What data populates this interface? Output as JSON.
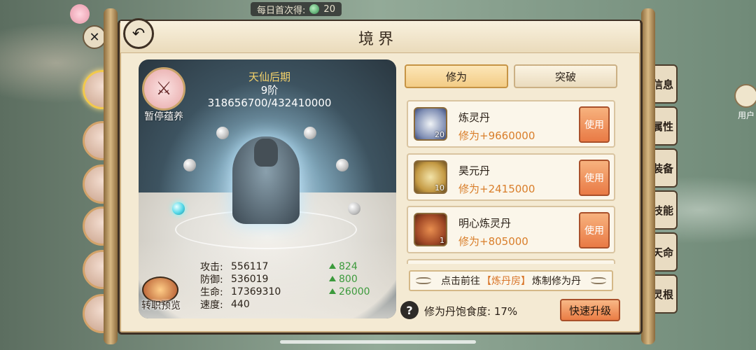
{
  "hud": {
    "daily_first_label": "每日首次得:",
    "daily_first_value": "20",
    "daily_icon": "jade-gem-icon"
  },
  "panel": {
    "title": "境界"
  },
  "realm": {
    "name": "天仙后期",
    "tier": "9阶",
    "progress_text": "318656700/432410000",
    "progress": {
      "current": 318656700,
      "max": 432410000
    },
    "cultivate_label": "暂停蕴养",
    "job_preview_label": "转职预览"
  },
  "stats": [
    {
      "label": "攻击:",
      "value": "556117",
      "bonus": "824"
    },
    {
      "label": "防御:",
      "value": "536019",
      "bonus": "800"
    },
    {
      "label": "生命:",
      "value": "17369310",
      "bonus": "26000"
    },
    {
      "label": "速度:",
      "value": "440",
      "bonus": ""
    }
  ],
  "tabs": [
    {
      "label": "修为",
      "active": true
    },
    {
      "label": "突破",
      "active": false
    }
  ],
  "items": [
    {
      "name": "炼灵丹",
      "effect": "修为+9660000",
      "count": "20",
      "button": "使用",
      "icon": "spirit-pill-icon"
    },
    {
      "name": "昊元丹",
      "effect": "修为+2415000",
      "count": "10",
      "button": "使用",
      "icon": "gourd-pill-icon"
    },
    {
      "name": "明心炼灵丹",
      "effect": "修为+805000",
      "count": "1",
      "button": "使用",
      "icon": "heart-pill-icon"
    }
  ],
  "guide": {
    "prefix": "点击前往",
    "link": "【炼丹房】",
    "suffix": "炼制修为丹"
  },
  "satiety": {
    "label": "修为丹饱食度:",
    "value": "17%",
    "help": "?"
  },
  "quick_upgrade_label": "快速升级",
  "side_tabs": [
    {
      "label": "信息",
      "icon": "scroll-icon"
    },
    {
      "label": "属性",
      "icon": "attribute-icon"
    },
    {
      "label": "装备",
      "icon": "armor-icon"
    },
    {
      "label": "技能",
      "icon": "book-icon"
    },
    {
      "label": "天命",
      "icon": "yin-yang-icon"
    },
    {
      "label": "灵根",
      "icon": "root-icon"
    }
  ],
  "user_label": "用户"
}
